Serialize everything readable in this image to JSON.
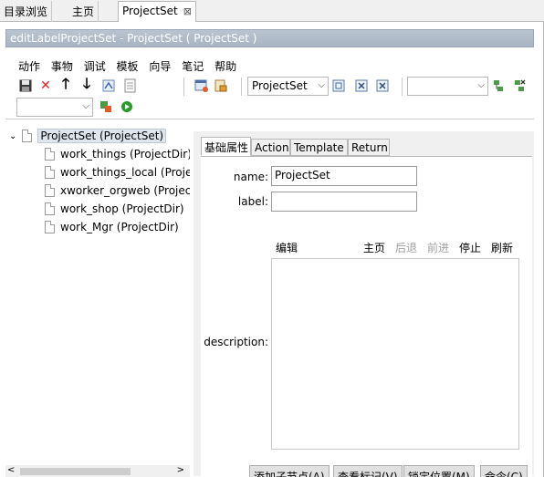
{
  "tabs": [
    {
      "label": "目录浏览"
    },
    {
      "label": "主页"
    },
    {
      "label": "ProjectSet",
      "close": "⊠"
    }
  ],
  "editor_title": "editLabelProjectSet - ProjectSet ( ProjectSet )",
  "menu": [
    "动作",
    "事物",
    "调试",
    "模板",
    "向导",
    "笔记",
    "帮助"
  ],
  "toolbar": {
    "selector_value": "ProjectSet",
    "empty_combo_value": ""
  },
  "tree": {
    "root": "ProjectSet (ProjectSet)",
    "children": [
      "work_things (ProjectDir)",
      "work_things_local (ProjectDir)",
      "xworker_orgweb (ProjectDir)",
      "work_shop (ProjectDir)",
      "work_Mgr (ProjectDir)"
    ]
  },
  "subtabs": [
    "基础属性",
    "Action",
    "Template",
    "Return"
  ],
  "form": {
    "name_label": "name:",
    "name_value": "ProjectSet",
    "label_label": "label:",
    "label_value": "",
    "description_label": "description:"
  },
  "html_toolbar": {
    "edit": "编辑",
    "home": "主页",
    "back": "后退",
    "forward": "前进",
    "stop": "停止",
    "refresh": "刷新"
  },
  "buttons": {
    "add_child": "添加子节点(A)",
    "view_marks": "查看标记(V)",
    "lock_position": "锁定位置(M)",
    "command": "命令(C)"
  },
  "colors": {
    "title_bar": "#a8b4c2",
    "delete_red": "#d22",
    "run_green": "#2a9a2a"
  }
}
